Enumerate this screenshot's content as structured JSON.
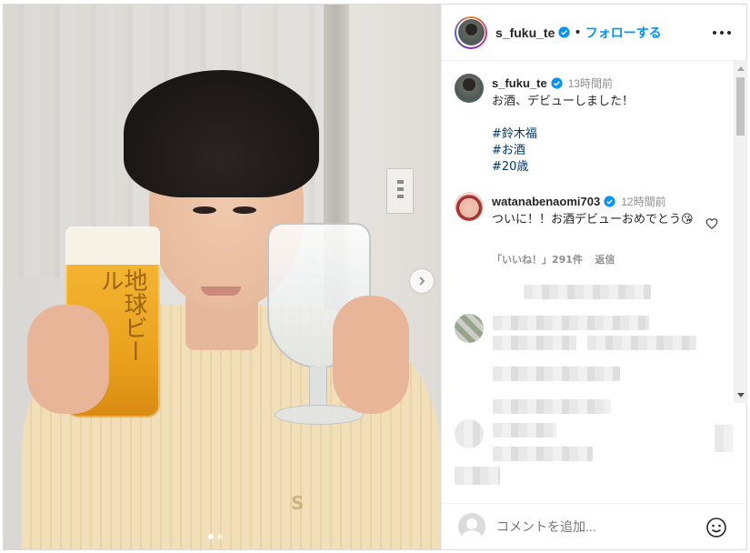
{
  "post": {
    "username": "s_fuku_te",
    "separator": "•",
    "follow_label": "フォローする",
    "caption_time": "13時間前",
    "caption_text": "お酒、デビューしました！",
    "hashtags": [
      "#鈴木福",
      "#お酒",
      "#20歳"
    ]
  },
  "reply": {
    "username": "watanabenaomi703",
    "time": "12時間前",
    "text": "ついに！！お酒デビューおめでとう😘",
    "likes": "「いいね！」291件",
    "reply_label": "返信"
  },
  "footer": {
    "comment_placeholder": "コメントを追加..."
  },
  "photo": {
    "beer_logo": "地球ビール"
  },
  "icons": {
    "verified": "verified-badge-icon",
    "more": "more-options-icon",
    "next": "chevron-right-icon",
    "heart": "heart-icon",
    "emoji": "emoji-icon"
  },
  "colors": {
    "link_blue": "#0095f6",
    "hashtag": "#00376b",
    "muted": "#8e8e8e"
  }
}
